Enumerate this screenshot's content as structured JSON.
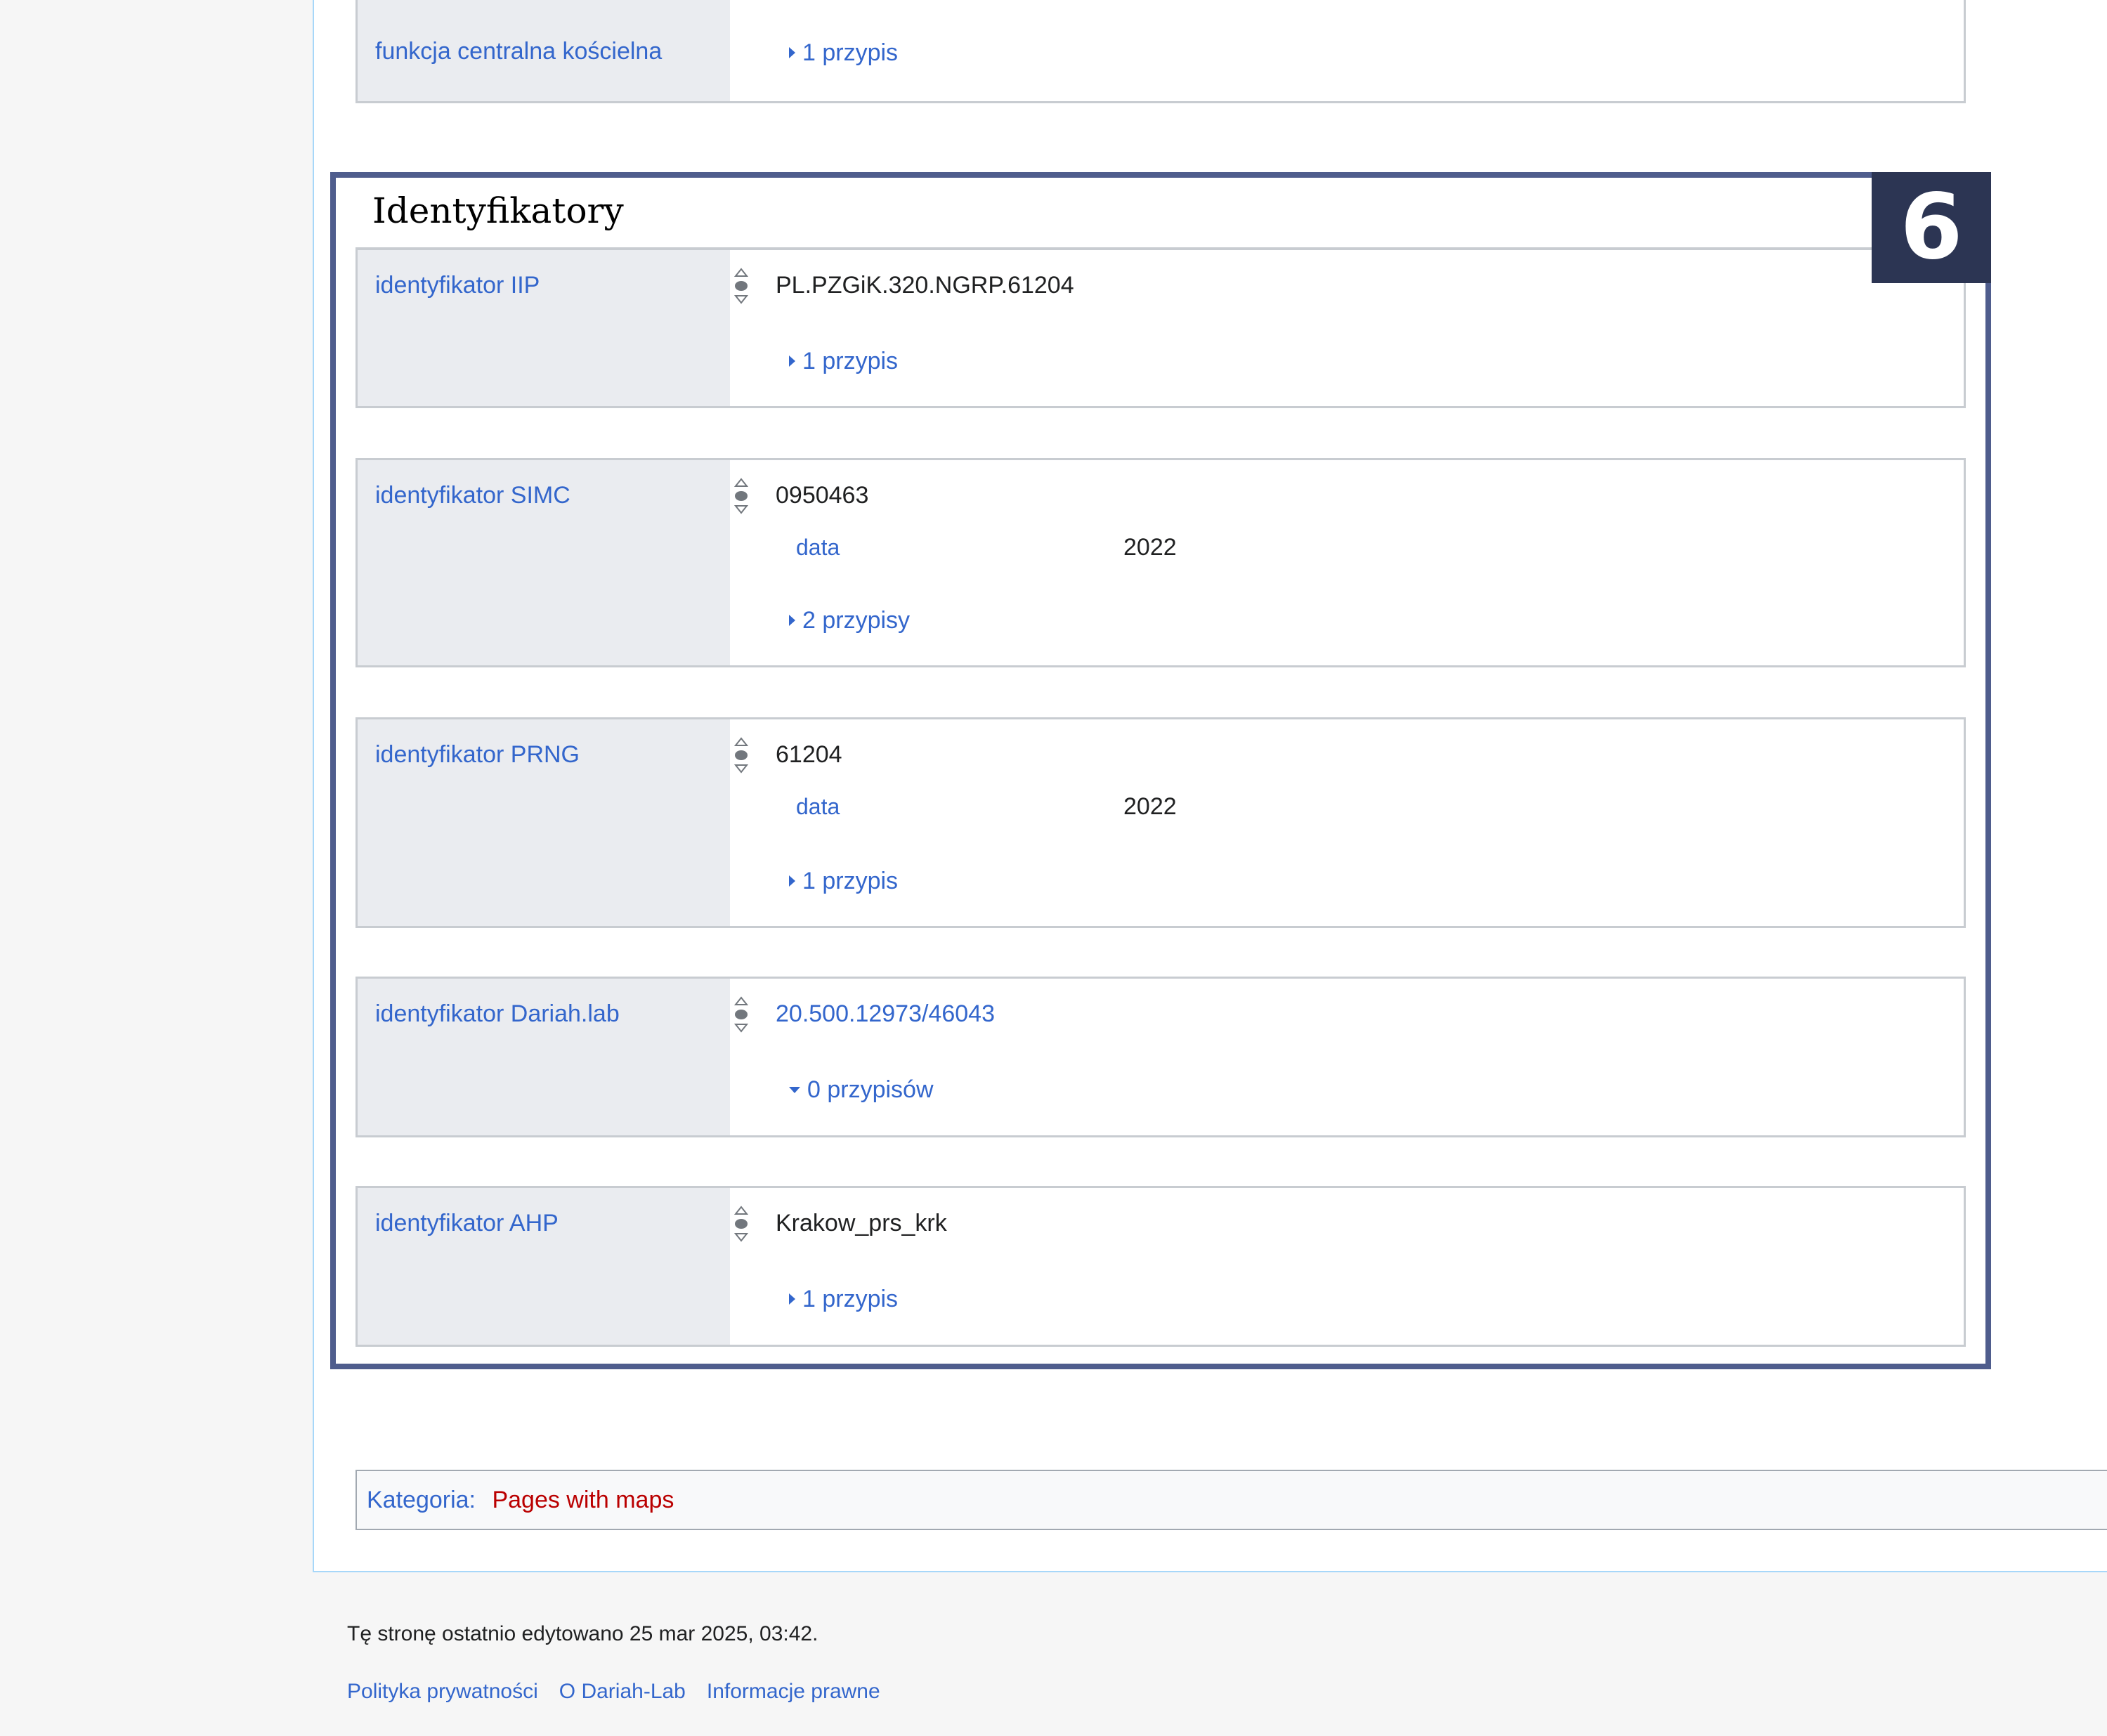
{
  "previous_statement": {
    "property": "funkcja centralna kościelna",
    "refs": "1 przypis"
  },
  "section": {
    "title": "Identyfikatory",
    "badge": "6"
  },
  "statements": [
    {
      "property": "identyfikator IIP",
      "value": "PL.PZGiK.320.NGRP.61204",
      "value_is_link": false,
      "qualifier": null,
      "refs": "1 przypis",
      "refs_expanded": false
    },
    {
      "property": "identyfikator SIMC",
      "value": "0950463",
      "value_is_link": false,
      "qualifier": {
        "property": "data",
        "value": "2022"
      },
      "refs": "2 przypisy",
      "refs_expanded": false
    },
    {
      "property": "identyfikator PRNG",
      "value": "61204",
      "value_is_link": false,
      "qualifier": {
        "property": "data",
        "value": "2022"
      },
      "refs": "1 przypis",
      "refs_expanded": false
    },
    {
      "property": "identyfikator Dariah.lab",
      "value": "20.500.12973/46043",
      "value_is_link": true,
      "qualifier": null,
      "refs": "0 przypisów",
      "refs_expanded": true
    },
    {
      "property": "identyfikator AHP",
      "value": "Krakow_prs_krk",
      "value_is_link": false,
      "qualifier": null,
      "refs": "1 przypis",
      "refs_expanded": false
    }
  ],
  "category": {
    "label": "Kategoria",
    "separator": ":",
    "link": "Pages with maps"
  },
  "footer": {
    "last_edited": "Tę stronę ostatnio edytowano 25 mar 2025, 03:42.",
    "links": [
      "Polityka prywatności",
      "O Dariah-Lab",
      "Informacje prawne"
    ]
  },
  "colors": {
    "link": "#3366cc",
    "category_link": "#ba0000",
    "highlight_frame": "#4f5d8d",
    "badge_bg": "#2c3553",
    "property_cell_bg": "#eaecf0"
  }
}
